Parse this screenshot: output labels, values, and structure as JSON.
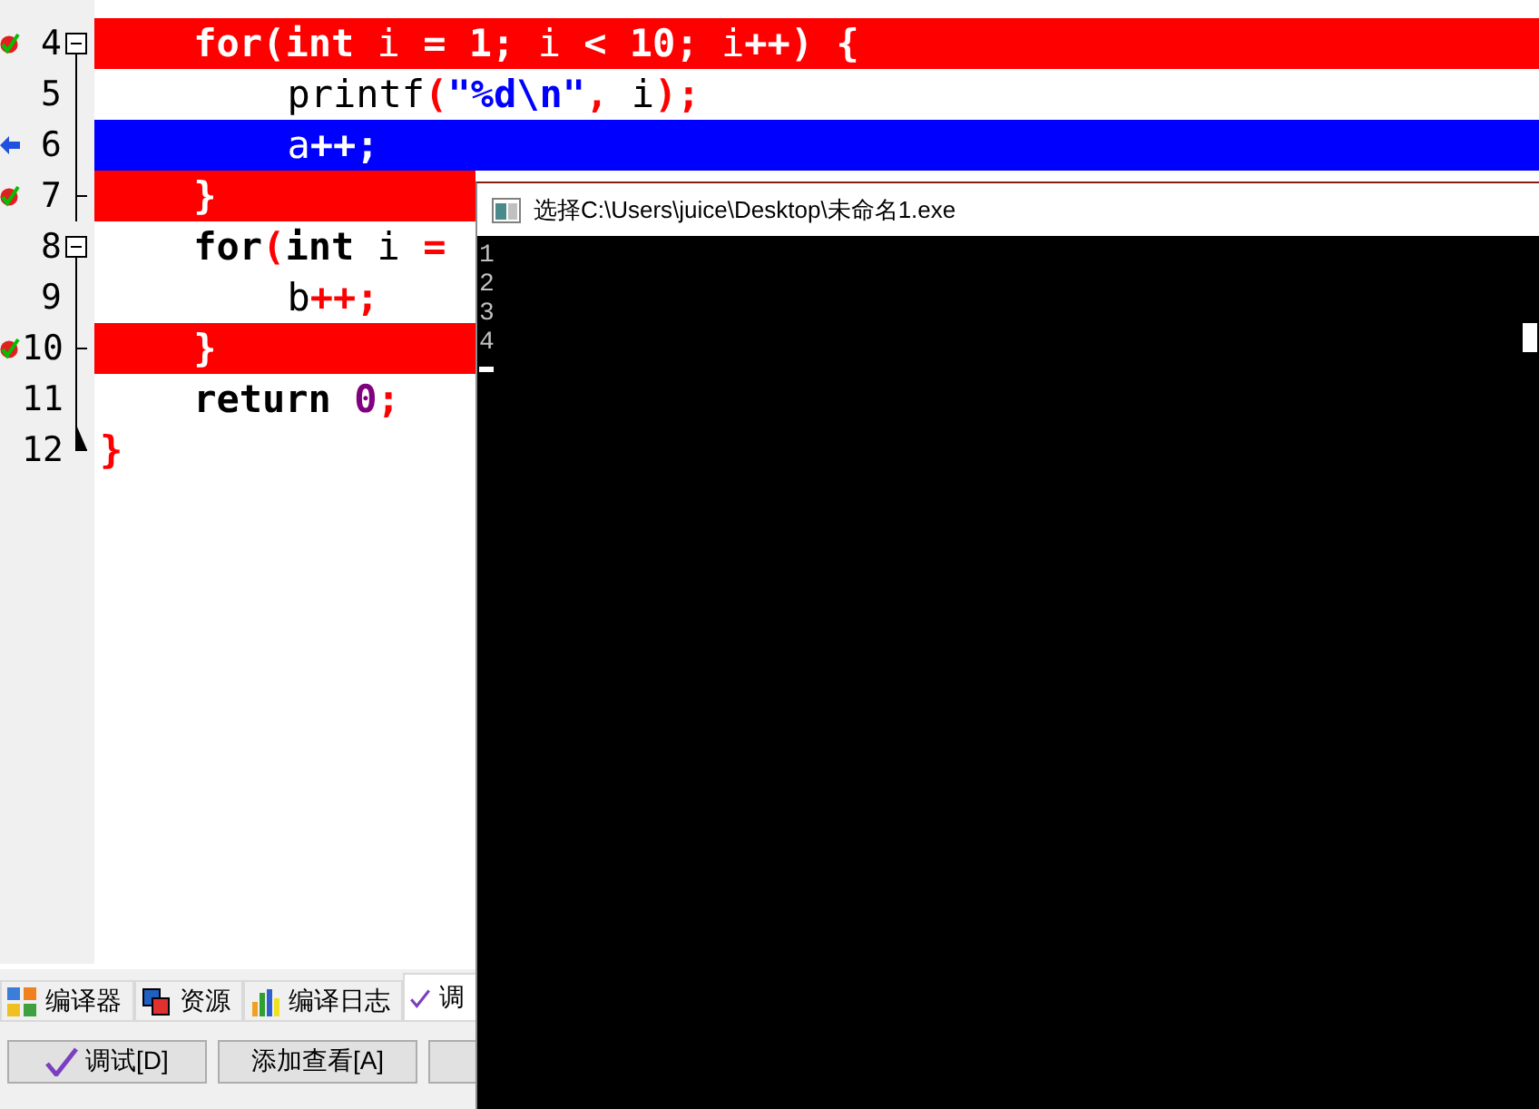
{
  "editor": {
    "lines": [
      {
        "number": "4",
        "kind": "breakpoint",
        "expanded": true,
        "tokens": [
          {
            "kind": "kw",
            "t": "for"
          },
          {
            "kind": "op",
            "t": "("
          },
          {
            "kind": "kw",
            "t": "int"
          },
          {
            "kind": "plain",
            "t": " i "
          },
          {
            "kind": "op",
            "t": "="
          },
          {
            "kind": "num",
            "t": " 1"
          },
          {
            "kind": "op",
            "t": ";"
          },
          {
            "kind": "plain",
            "t": " i "
          },
          {
            "kind": "op",
            "t": "<"
          },
          {
            "kind": "num",
            "t": " 10"
          },
          {
            "kind": "op",
            "t": ";"
          },
          {
            "kind": "plain",
            "t": " i"
          },
          {
            "kind": "op",
            "t": "++) {"
          }
        ],
        "children": [
          {
            "number": "5",
            "kind": "normal",
            "tokens": [
              {
                "kind": "plain",
                "t": "printf"
              },
              {
                "kind": "op",
                "t": "("
              },
              {
                "kind": "str",
                "t": "\"%d\\n\""
              },
              {
                "kind": "op",
                "t": ","
              },
              {
                "kind": "plain",
                "t": " i"
              },
              {
                "kind": "op",
                "t": ");"
              }
            ]
          },
          {
            "number": "6",
            "kind": "current",
            "tokens": [
              {
                "kind": "plain",
                "t": "a"
              },
              {
                "kind": "op",
                "t": "++;"
              }
            ]
          }
        ]
      },
      {
        "number": "7",
        "kind": "breakpoint",
        "tokens": [
          {
            "kind": "op",
            "t": "}"
          }
        ]
      },
      {
        "number": "8",
        "kind": "normal",
        "expanded": true,
        "tokens": [
          {
            "kind": "kw",
            "t": "for"
          },
          {
            "kind": "op",
            "t": "("
          },
          {
            "kind": "kw",
            "t": "int"
          },
          {
            "kind": "plain",
            "t": " i "
          },
          {
            "kind": "op",
            "t": "="
          }
        ],
        "children": [
          {
            "number": "9",
            "kind": "normal",
            "tokens": [
              {
                "kind": "plain",
                "t": "b"
              },
              {
                "kind": "op",
                "t": "++;"
              }
            ]
          }
        ]
      },
      {
        "number": "10",
        "kind": "breakpoint",
        "tokens": [
          {
            "kind": "op",
            "t": "}"
          }
        ]
      },
      {
        "number": "11",
        "kind": "normal",
        "tokens": [
          {
            "kind": "kw",
            "t": "return"
          },
          {
            "kind": "num",
            "t": " 0"
          },
          {
            "kind": "op",
            "t": ";"
          }
        ]
      }
    ],
    "end_line": {
      "number": "12",
      "kind": "normal",
      "tokens": [
        {
          "kind": "op",
          "t": "}"
        }
      ]
    }
  },
  "bottom_panel": {
    "tabs": [
      {
        "label": "编译器",
        "selected": false
      },
      {
        "label": "资源",
        "selected": false
      },
      {
        "label": "编译日志",
        "selected": false
      },
      {
        "label": "调",
        "selected": true
      }
    ],
    "buttons": [
      {
        "label": "调试[D]"
      },
      {
        "label": "添加查看[A]"
      }
    ]
  },
  "console": {
    "title": "选择C:\\Users\\juice\\Desktop\\未命名1.exe",
    "output": [
      "1",
      "2",
      "3",
      "4"
    ]
  }
}
